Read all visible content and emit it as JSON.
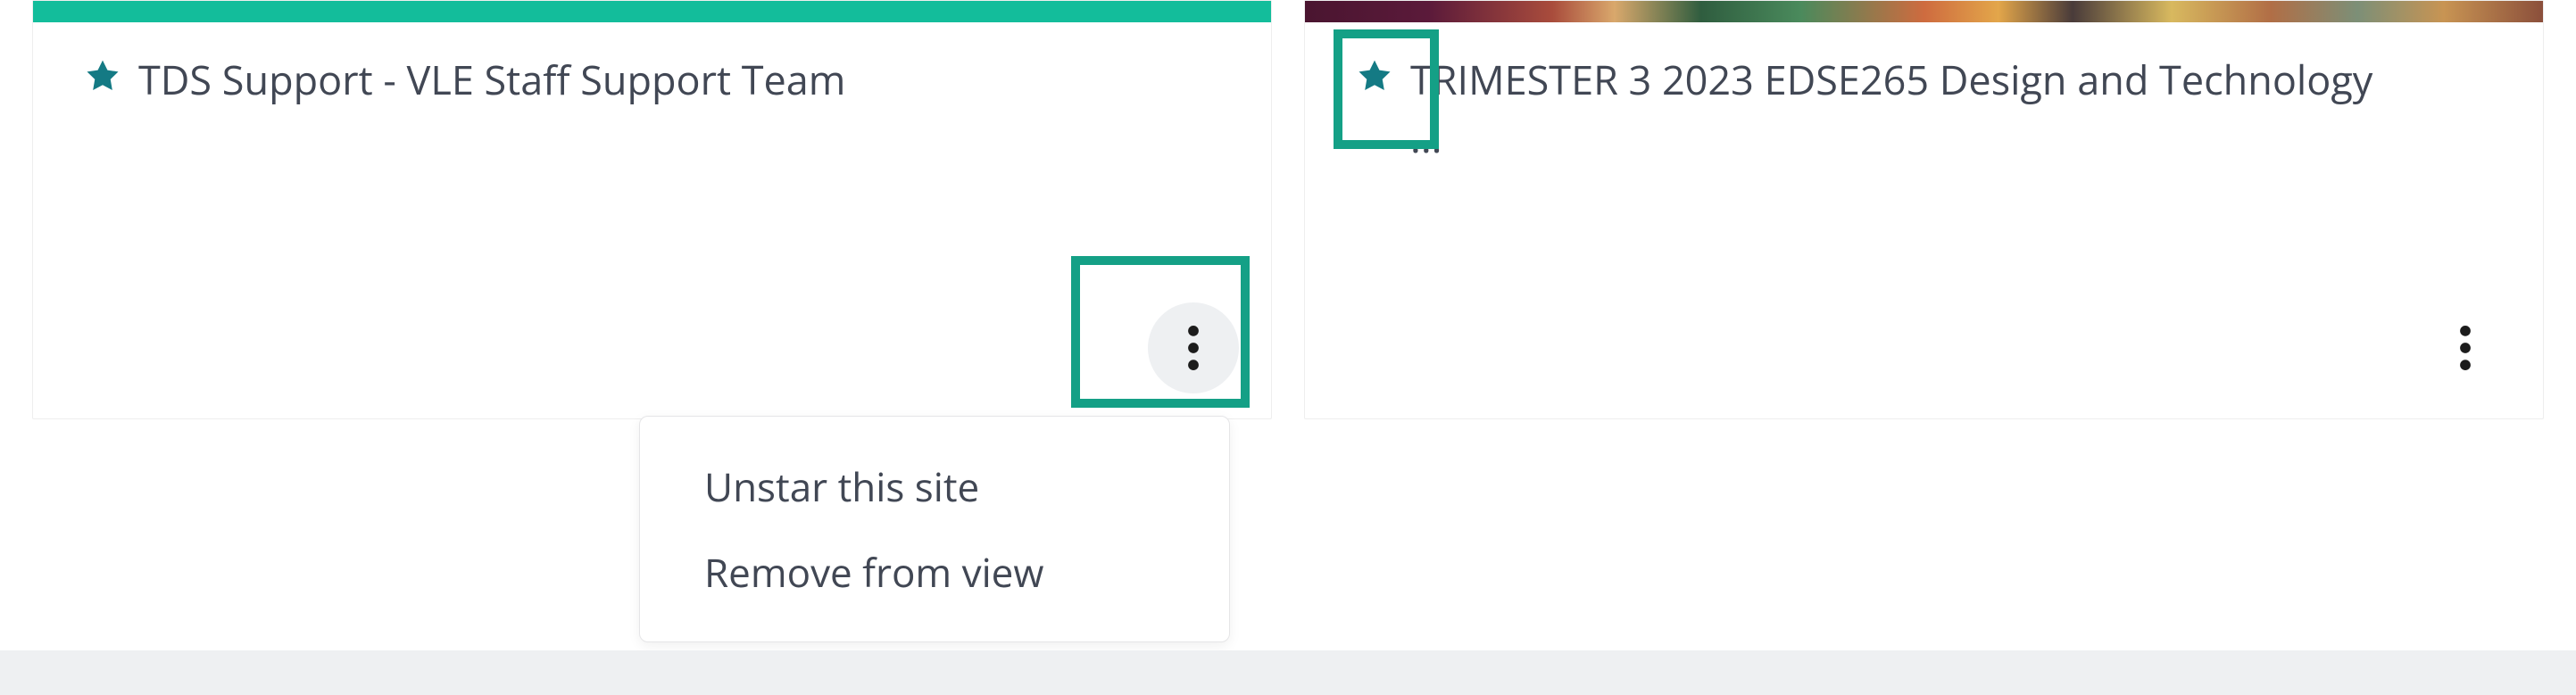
{
  "cards": [
    {
      "title": "TDS Support - VLE Staff Support Team",
      "banner_style": "teal",
      "starred": true
    },
    {
      "title": "TRIMESTER 3 2023 EDSE265 Design and Technology ...",
      "banner_style": "image",
      "starred": true
    }
  ],
  "menu": {
    "unstar_label": "Unstar this site",
    "remove_label": "Remove from view"
  },
  "colors": {
    "teal": "#13bd9b",
    "star": "#147a84",
    "highlight": "#14a086",
    "text": "#414754"
  }
}
